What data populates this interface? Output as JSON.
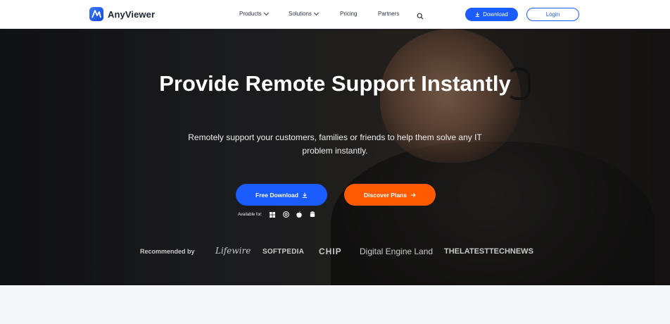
{
  "header": {
    "brand": "AnyViewer",
    "nav": [
      {
        "label": "Products",
        "has_dropdown": true
      },
      {
        "label": "Solutions",
        "has_dropdown": true
      },
      {
        "label": "Pricing",
        "has_dropdown": false
      },
      {
        "label": "Partners",
        "has_dropdown": false
      }
    ],
    "download_label": "Download",
    "login_label": "Login"
  },
  "hero": {
    "title": "Provide Remote Support Instantly",
    "subtitle": "Remotely support your customers, families or friends to help them solve any IT problem instantly.",
    "free_download_label": "Free Download",
    "discover_plans_label": "Discover Plans",
    "available_label": "Available for:",
    "platform_icons": [
      "windows-icon",
      "chrome-os-icon",
      "apple-icon",
      "android-icon"
    ],
    "recommended_label": "Recommended by",
    "recommended_brands": [
      "Lifewire",
      "SOFTPEDIA",
      "CHIP",
      "Digital Engine Land",
      "THELATESTTECHNEWS"
    ]
  },
  "colors": {
    "primary": "#1a5cff",
    "accent": "#ff5a00",
    "header_bg": "#ffffff",
    "hero_overlay": "#1a1b1e"
  }
}
